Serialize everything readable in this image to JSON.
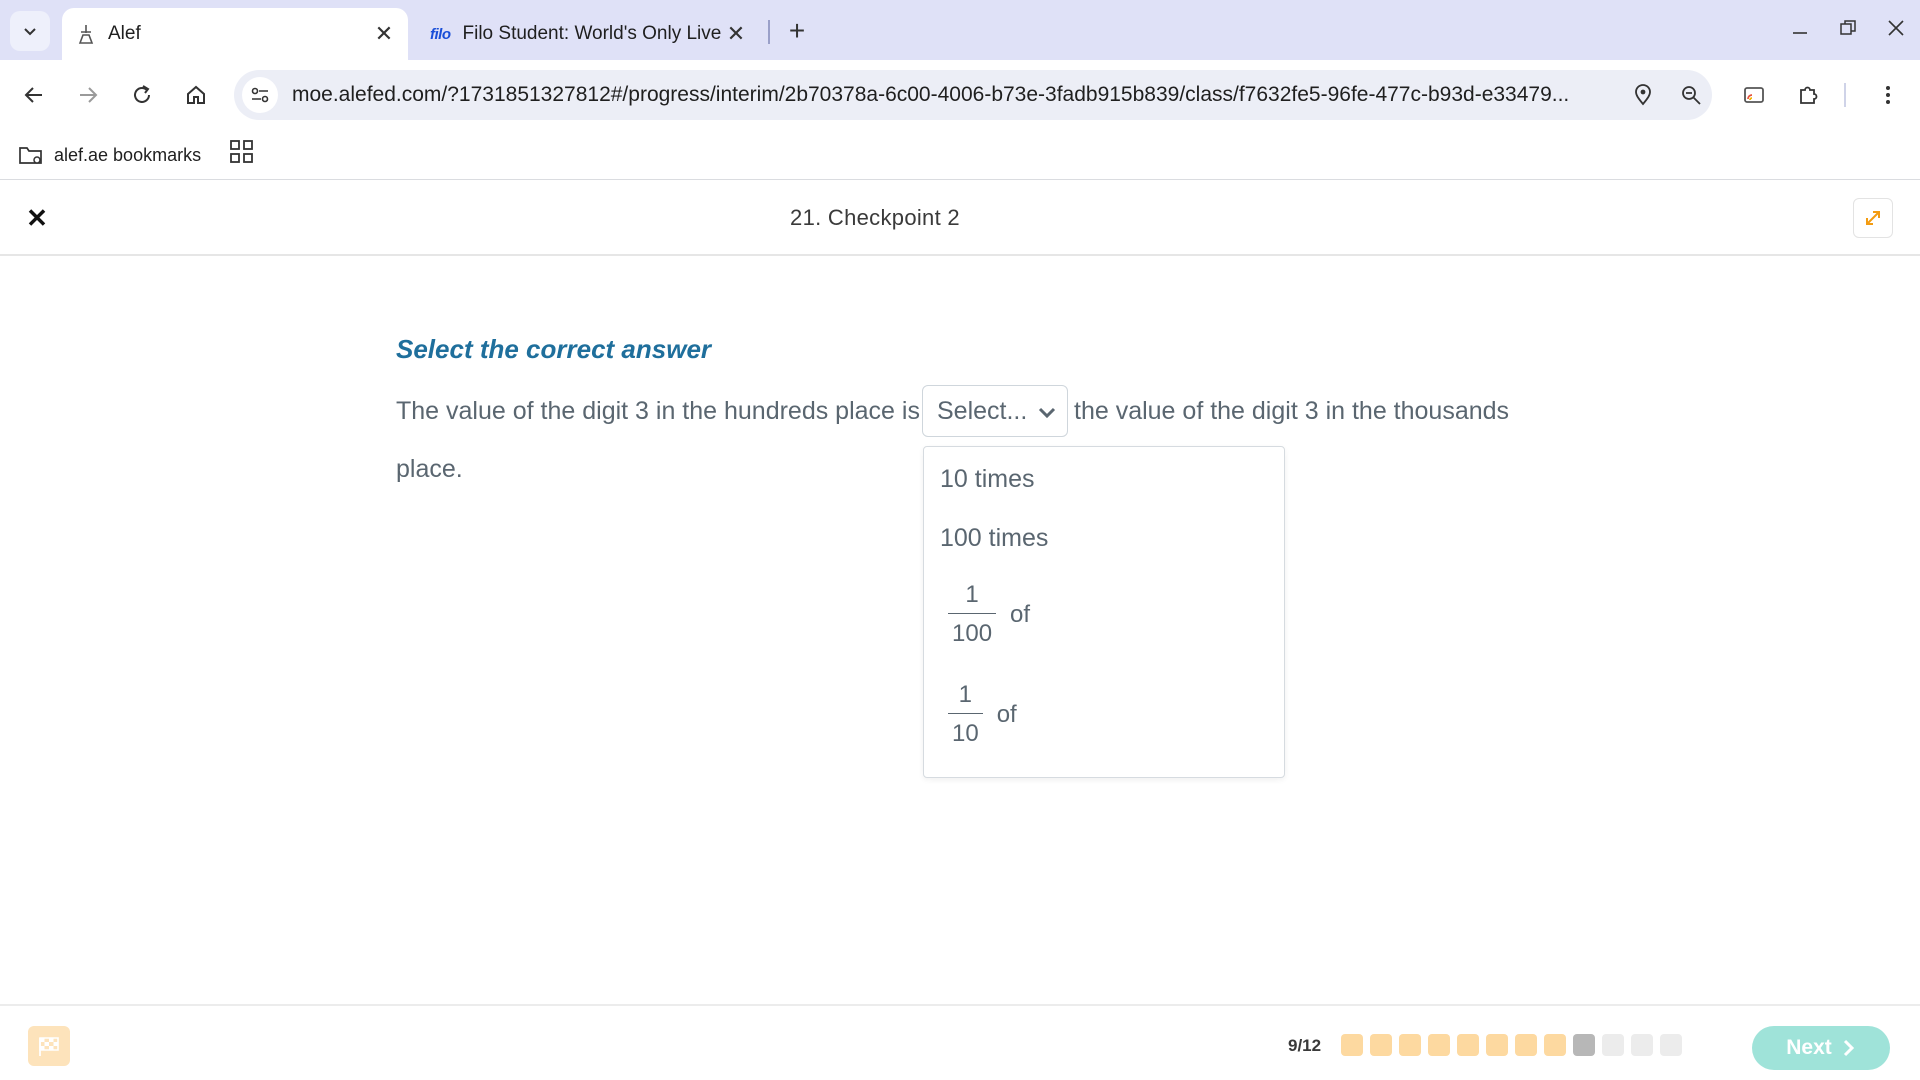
{
  "browser": {
    "tabs": [
      {
        "title": "Alef",
        "active": true
      },
      {
        "title": "Filo Student: World's Only Live I",
        "logo": "filo",
        "active": false
      }
    ],
    "url": "moe.alefed.com/?1731851327812#/progress/interim/2b70378a-6c00-4006-b73e-3fadb915b839/class/f7632fe5-96fe-477c-b93d-e33479...",
    "bookmarks": [
      {
        "label": "alef.ae bookmarks"
      }
    ]
  },
  "header": {
    "title": "21. Checkpoint 2"
  },
  "question": {
    "instruction": "Select the correct answer",
    "text_before": "The value of the digit 3 in the hundreds place is",
    "text_after": "the value of the digit 3 in the thousands",
    "text_line2": "place.",
    "select_placeholder": "Select...",
    "options": [
      {
        "label": "10 times"
      },
      {
        "label": "100 times"
      },
      {
        "numerator": "1",
        "denominator": "100",
        "suffix": "of"
      },
      {
        "numerator": "1",
        "denominator": "10",
        "suffix": "of"
      }
    ]
  },
  "footer": {
    "progress_label": "9/12",
    "progress": {
      "current": 9,
      "total": 12,
      "answered": 8
    },
    "next_label": "Next"
  },
  "colors": {
    "accent_blue": "#1f6f9c",
    "answered_dot": "#fdd9a0",
    "current_dot": "#b7b7b7",
    "pending_dot": "#ececec",
    "next_button": "#9fe3d9",
    "expand_icon": "#f39c12"
  }
}
